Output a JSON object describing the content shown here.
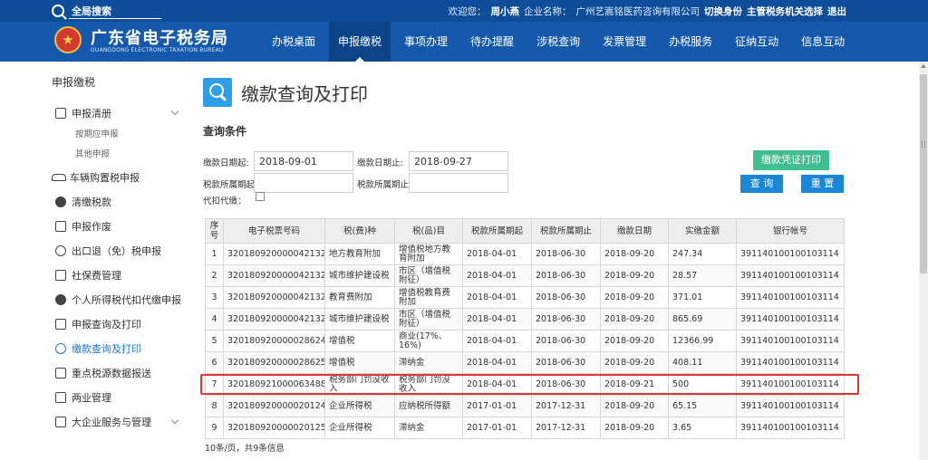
{
  "topbar": {
    "search_label": "全局搜索",
    "welcome": "欢迎您：",
    "user_name": "周小燕",
    "company_label": "企业名称：",
    "company_name": "广州艺嵩铭医药咨询有限公司",
    "switch_identity": "切换身份",
    "tax_office": "主管税务机关选择",
    "logout": "退出"
  },
  "header": {
    "title": "广东省电子税务局",
    "subtitle": "GUANGDONG ELECTRONIC TAXATION BUREAU",
    "nav": [
      "办税桌面",
      "申报缴税",
      "事项办理",
      "待办提醒",
      "涉税查询",
      "发票管理",
      "办税服务",
      "征纳互动",
      "信息互动"
    ],
    "active_nav": "申报缴税"
  },
  "sidebar": {
    "title": "申报缴税",
    "items": [
      {
        "label": "申报清册",
        "icon": "list-icon"
      },
      {
        "label": "按期应申报",
        "icon": ""
      },
      {
        "label": "其他申报",
        "icon": ""
      },
      {
        "label": "车辆购置税申报",
        "icon": "car-icon"
      },
      {
        "label": "清缴税款",
        "icon": "money-bag-icon"
      },
      {
        "label": "申报作废",
        "icon": "doc-cancel-icon"
      },
      {
        "label": "出口退（免）税申报",
        "icon": "export-icon"
      },
      {
        "label": "社保费管理",
        "icon": "ledger-icon"
      },
      {
        "label": "个人所得税代扣代缴申报",
        "icon": "person-icon"
      },
      {
        "label": "申报查询及打印",
        "icon": "print-icon"
      },
      {
        "label": "缴款查询及打印",
        "icon": "yen-icon"
      },
      {
        "label": "重点税源数据报送",
        "icon": "bar-chart-icon"
      },
      {
        "label": "两业管理",
        "icon": "box-icon"
      },
      {
        "label": "大企业服务与管理",
        "icon": "building-icon"
      }
    ]
  },
  "page": {
    "title": "缴款查询及打印",
    "section_title": "查询条件"
  },
  "form": {
    "pay_date_start_label": "缴款日期起:",
    "pay_date_start": "2018-09-01",
    "pay_date_end_label": "缴款日期止:",
    "pay_date_end": "2018-09-27",
    "period_start_label": "税款所属期起:",
    "period_start": "",
    "period_end_label": "税款所属期止:",
    "period_end": "",
    "agent_label": "代扣代缴：",
    "print_button": "缴款凭证打印",
    "query_button": "查 询",
    "reset_button": "重 置"
  },
  "table": {
    "headers": [
      "序号",
      "电子税票号码",
      "税(费)种",
      "税(品)目",
      "税款所属期起",
      "税款所属期止",
      "缴款日期",
      "实缴金额",
      "银行帐号"
    ],
    "rows": [
      [
        "1",
        "320180920000042132",
        "地方教育附加",
        "增值税地方教育附加",
        "2018-04-01",
        "2018-06-30",
        "2018-09-20",
        "247.34",
        "391140100100103114"
      ],
      [
        "2",
        "320180920000042132",
        "城市维护建设税",
        "市区（增值税附征）",
        "2018-04-01",
        "2018-06-30",
        "2018-09-20",
        "28.57",
        "391140100100103114"
      ],
      [
        "3",
        "320180920000042132",
        "教育费附加",
        "增值税教育费附加",
        "2018-04-01",
        "2018-06-30",
        "2018-09-20",
        "371.01",
        "391140100100103114"
      ],
      [
        "4",
        "320180920000042132",
        "城市维护建设税",
        "市区（增值税附征）",
        "2018-04-01",
        "2018-06-30",
        "2018-09-20",
        "865.69",
        "391140100100103114"
      ],
      [
        "5",
        "320180920000028624",
        "增值税",
        "商业(17%、16%)",
        "2018-04-01",
        "2018-06-30",
        "2018-09-20",
        "12366.99",
        "391140100100103114"
      ],
      [
        "6",
        "320180920000028625",
        "增值税",
        "滞纳金",
        "2018-04-01",
        "2018-06-30",
        "2018-09-20",
        "408.11",
        "391140100100103114"
      ],
      [
        "7",
        "320180921000063488",
        "税务部门罚没收入",
        "税务部门罚没收入",
        "2018-04-01",
        "2018-06-30",
        "2018-09-21",
        "500",
        "391140100100103114"
      ],
      [
        "8",
        "320180920000020124",
        "企业所得税",
        "应纳税所得额",
        "2017-01-01",
        "2017-12-31",
        "2018-09-20",
        "65.15",
        "391140100100103114"
      ],
      [
        "9",
        "320180920000020125",
        "企业所得税",
        "滞纳金",
        "2017-01-01",
        "2017-12-31",
        "2018-09-20",
        "3.65",
        "391140100100103114"
      ]
    ],
    "footer": "10条/页，共9条信息"
  }
}
